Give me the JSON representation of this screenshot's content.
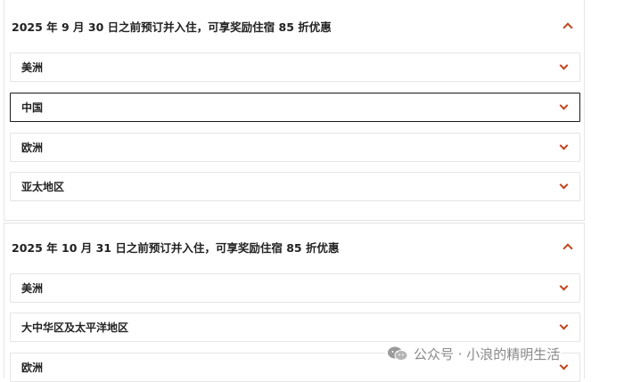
{
  "sections": [
    {
      "title": "2025 年 9 月 30 日之前预订并入住，可享奖励住宿 85 折优惠",
      "regions": [
        "美洲",
        "中国",
        "欧洲",
        "亚太地区"
      ]
    },
    {
      "title": "2025 年 10 月 31 日之前预订并入住，可享奖励住宿 85 折优惠",
      "regions": [
        "美洲",
        "大中华区及太平洋地区",
        "欧洲"
      ]
    }
  ],
  "watermark": {
    "text": "公众号 · 小浪的精明生活",
    "icon": "wechat-icon"
  },
  "colors": {
    "accent": "#c0451d",
    "border": "#e5e5e5",
    "selected_border": "#1a1a1a"
  }
}
